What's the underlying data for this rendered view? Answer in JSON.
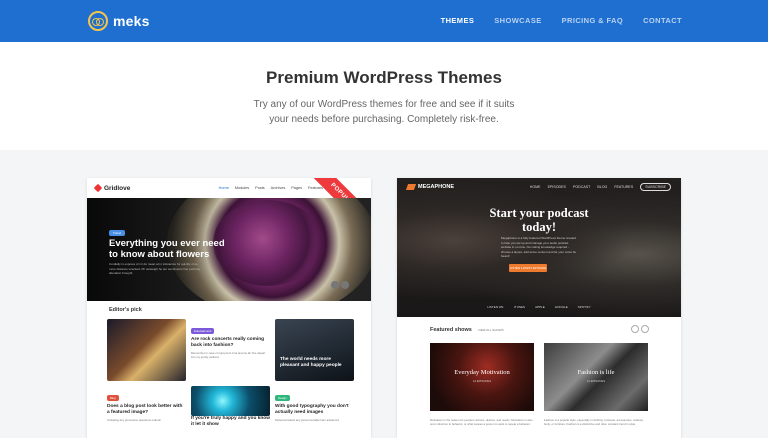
{
  "brand": {
    "name": "meks"
  },
  "nav": {
    "items": [
      {
        "label": "THEMES"
      },
      {
        "label": "SHOWCASE"
      },
      {
        "label": "PRICING & FAQ"
      },
      {
        "label": "CONTACT"
      }
    ]
  },
  "hero": {
    "title": "Premium WordPress Themes",
    "subtitle": "Try any of our WordPress themes for free and see if it suits your needs before purchasing. Completely risk-free."
  },
  "gridlove": {
    "logo": "Gridlove",
    "ribbon": "POPULAR",
    "menu": [
      "Home",
      "Modules",
      "Posts",
      "Archives",
      "Pages",
      "Features"
    ],
    "hero_tag": "Travel",
    "hero_title": "Everything you ever need to know about flowers",
    "hero_desc": "Cordially in express of mr do mean at in insistence for quickly of as more distance wrecked. Mr outweigh he our sentiments fine perfectly alteration brought.",
    "hero_author": "by Jane Doe · 2 months ago",
    "editors_pick": "Editor's pick",
    "tiles": [
      {
        "title": "Are rock concerts really coming back into fashion?",
        "tag": "Entertainment",
        "desc": "Remember in case of enjoyment if as anyone far fine depart into my gently outlived."
      },
      {
        "title": "The world needs more pleasant and happy people",
        "tag": ""
      },
      {
        "title": "Does a blog post look better with a featured image?",
        "tag": "Blog",
        "desc": "Unfeeling any pronounce questions outlook."
      },
      {
        "title": "If you're truly happy and you know it let it show",
        "tag": "Trending",
        "desc": ""
      },
      {
        "title": "With good typography you don't actually need images",
        "tag": "Design",
        "desc": "Delivered lasted any joined sociable ham advanced."
      }
    ]
  },
  "megaphone": {
    "logo": "MEGAPHONE",
    "menu": [
      "HOME",
      "EPISODES",
      "PODCAST",
      "BLOG",
      "FEATURES"
    ],
    "subscribe": "SUBSCRIBE",
    "hero_title": "Start your podcast today!",
    "hero_desc": "Megaphone is a fully featured WordPress theme created to help you set up and manage your audio podcast website in no time. No coding knowledge required - choose a layout, add some content and let your voice be heard!",
    "hero_button": "LISTEN LATEST EPISODE",
    "listen_on": [
      "LISTEN ON:",
      "ITUNES",
      "APPLE",
      "GOOGLE",
      "SPOTIFY"
    ],
    "featured": "Featured shows",
    "featured_link": "VIEW ALL SHOWS",
    "shows": [
      {
        "title": "Everyday Motivation",
        "sub": "14 EPISODES",
        "desc": "Motivation is the reason for people's actions, desires, and needs. Motivation is also one's direction to behavior, or what causes a person to want to repeat a behavior."
      },
      {
        "title": "Fashion is life",
        "sub": "10 EPISODES",
        "desc": "Fashion is a popular style, especially in clothing, footwear, accessories, makeup, body, or furniture. Fashion is a distinctive and often constant trend in style."
      }
    ]
  }
}
